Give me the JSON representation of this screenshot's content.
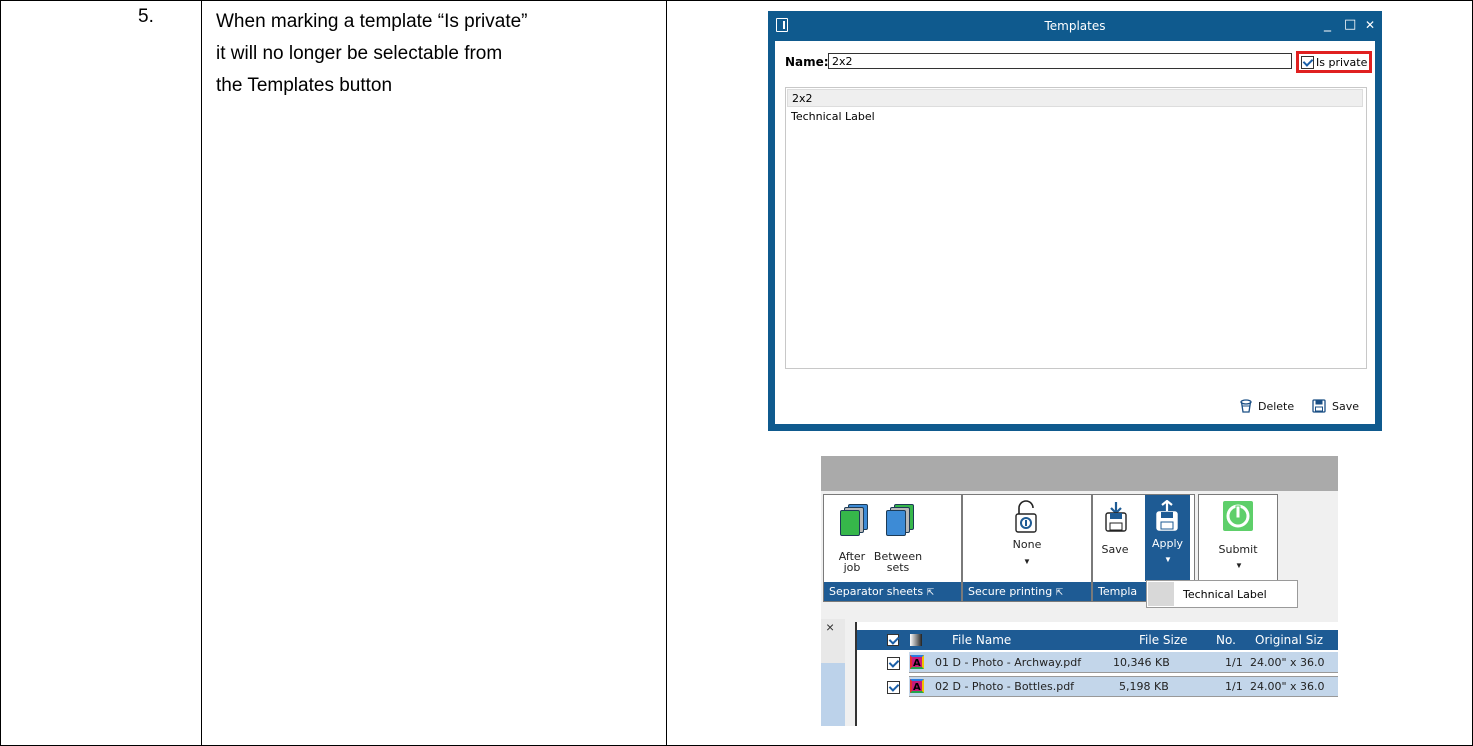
{
  "step": {
    "number": "5.",
    "description_lines": [
      "When marking a template “Is private”",
      "it will no longer be selectable from",
      "the Templates button"
    ]
  },
  "dialog": {
    "title": "Templates",
    "window_controls": {
      "minimize": "_",
      "maximize": "□",
      "close": "✕"
    },
    "name_label": "Name:",
    "name_value": "2x2",
    "is_private_label": "Is private",
    "is_private_checked": true,
    "templates": [
      "2x2",
      "Technical Label"
    ],
    "selected_template": "2x2",
    "delete_label": "Delete",
    "save_label": "Save",
    "accent_color": "#0f5a8e",
    "highlight_color": "#e02020"
  },
  "ribbon": {
    "separator_after_job": [
      "After",
      "job"
    ],
    "separator_between_sets": [
      "Between",
      "sets"
    ],
    "separator_group": "Separator sheets",
    "secure_none": "None",
    "secure_group": "Secure printing",
    "template_save": "Save",
    "template_apply": "Apply",
    "template_group": "Templa",
    "submit": "Submit",
    "apply_menu_item": "Technical Label",
    "close_glyph": "×",
    "group_color": "#1e5b94"
  },
  "file_list": {
    "columns": [
      "File Name",
      "File Size",
      "No.",
      "Original Siz"
    ],
    "rows": [
      {
        "name": "01 D - Photo - Archway.pdf",
        "size": "10,346 KB",
        "no": "1/1",
        "orig": "24.00\" x 36.0"
      },
      {
        "name": "02 D - Photo - Bottles.pdf",
        "size": "5,198 KB",
        "no": "1/1",
        "orig": "24.00\" x 36.0"
      }
    ]
  }
}
